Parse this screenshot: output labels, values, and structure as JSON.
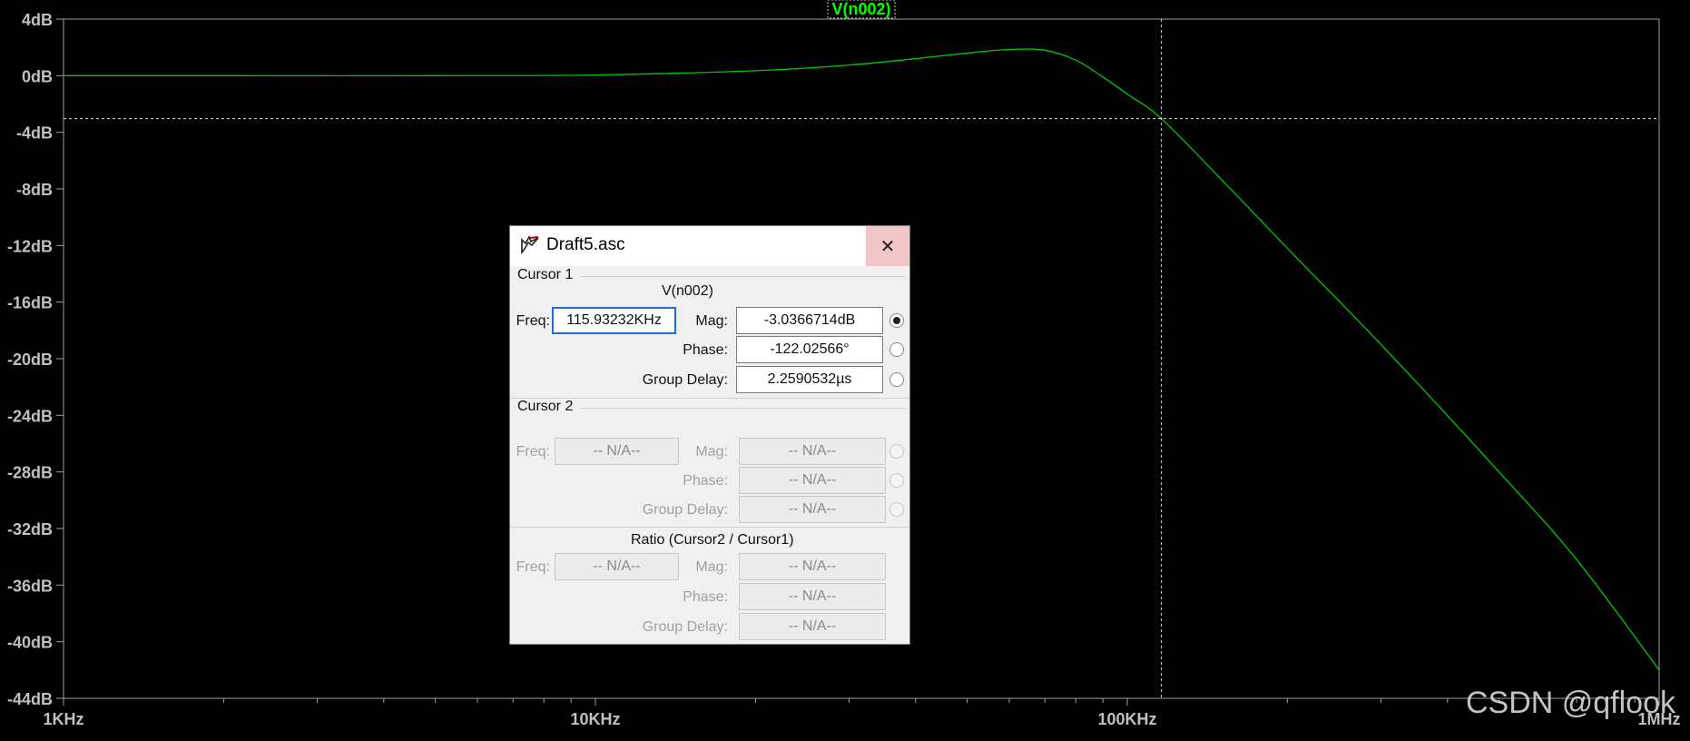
{
  "plot": {
    "trace_name": "V(n002)",
    "colors": {
      "background": "#000000",
      "trace": "#00c800",
      "axis": "#a0a0a0",
      "label": "#c0c0c0",
      "trace_label": "#00ff00"
    },
    "y_ticks": [
      "4dB",
      "0dB",
      "-4dB",
      "-8dB",
      "-12dB",
      "-16dB",
      "-20dB",
      "-24dB",
      "-28dB",
      "-32dB",
      "-36dB",
      "-40dB",
      "-44dB"
    ],
    "x_ticks": [
      "1KHz",
      "10KHz",
      "100KHz",
      "1MHz"
    ]
  },
  "chart_data": {
    "type": "line",
    "title": "V(n002)",
    "xlabel": "",
    "ylabel": "",
    "xscale": "log",
    "xlim": [
      1000,
      1000000
    ],
    "ylim": [
      -44,
      4
    ],
    "grid": false,
    "series": [
      {
        "name": "V(n002)",
        "x": [
          1000,
          2000,
          5000,
          10000,
          20000,
          30000,
          40000,
          50000,
          60000,
          70000,
          80000,
          90000,
          100000,
          115932,
          150000,
          200000,
          300000,
          500000,
          700000,
          1000000
        ],
        "y": [
          0,
          0,
          0,
          0.05,
          0.35,
          0.75,
          1.2,
          1.6,
          1.85,
          1.8,
          1.1,
          -0.1,
          -1.3,
          -3.04,
          -7.3,
          -12.2,
          -19.0,
          -28.0,
          -34.2,
          -42.0
        ]
      }
    ],
    "cursor": {
      "x": 115932,
      "y": -3.0366714
    }
  },
  "watermark": "CSDN @qflook",
  "dialog": {
    "title": "Draft5.asc",
    "close_glyph": "✕",
    "cursor1": {
      "heading": "Cursor 1",
      "trace": "V(n002)",
      "freq_label": "Freq:",
      "freq_value": "115.93232KHz",
      "mag_label": "Mag:",
      "mag_value": "-3.0366714dB",
      "phase_label": "Phase:",
      "phase_value": "-122.02566°",
      "gd_label": "Group Delay:",
      "gd_value": "2.2590532µs"
    },
    "cursor2": {
      "heading": "Cursor 2",
      "freq_label": "Freq:",
      "freq_value": "-- N/A--",
      "mag_label": "Mag:",
      "mag_value": "-- N/A--",
      "phase_label": "Phase:",
      "phase_value": "-- N/A--",
      "gd_label": "Group Delay:",
      "gd_value": "-- N/A--"
    },
    "ratio": {
      "heading": "Ratio (Cursor2 / Cursor1)",
      "freq_label": "Freq:",
      "freq_value": "-- N/A--",
      "mag_label": "Mag:",
      "mag_value": "-- N/A--",
      "phase_label": "Phase:",
      "phase_value": "-- N/A--",
      "gd_label": "Group Delay:",
      "gd_value": "-- N/A--"
    }
  }
}
